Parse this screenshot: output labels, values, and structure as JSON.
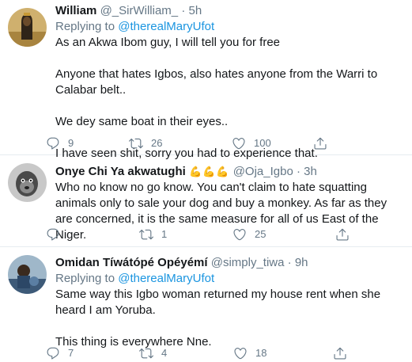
{
  "tweets": [
    {
      "name": "William",
      "name_emoji": "",
      "handle": "@_SirWilliam_",
      "time": "5h",
      "replying_label": "Replying to ",
      "replying_mention": "@therealMaryUfot",
      "paragraphs": [
        "As an Akwa Ibom guy, I will tell you for free",
        "Anyone that hates Igbos, also hates anyone from the Warri to Calabar belt..",
        "We dey same boat in their eyes..",
        "I have seen shit, sorry you had to experience that."
      ],
      "replies": "9",
      "retweets": "26",
      "likes": "100"
    },
    {
      "name": "Onye Chi Ya akwatughi",
      "name_emoji": "💪💪💪",
      "handle": "@Oja_Igbo",
      "time": "3h",
      "replying_label": "",
      "replying_mention": "",
      "paragraphs": [
        "Who no know no go know. You can't claim to hate squatting animals only to sale your dog and buy a monkey. As far as they are concerned, it is the same measure for all of us East of the Niger."
      ],
      "replies": "",
      "retweets": "1",
      "likes": "25"
    },
    {
      "name": "Omidan Tíwátópé Opéyémí",
      "name_emoji": "",
      "handle": "@simply_tiwa",
      "time": "9h",
      "replying_label": "Replying to ",
      "replying_mention": "@therealMaryUfot",
      "paragraphs": [
        "Same way this Igbo woman returned my house rent when she heard I am Yoruba.",
        "This thing is everywhere Nne."
      ],
      "replies": "7",
      "retweets": "4",
      "likes": "18"
    }
  ],
  "separator": "·",
  "icons": {
    "reply": "reply-icon",
    "retweet": "retweet-icon",
    "like": "heart-icon",
    "share": "share-icon"
  },
  "colors": {
    "text": "#14171a",
    "muted": "#657786",
    "link": "#1b95e0",
    "border": "#e6ecf0"
  }
}
